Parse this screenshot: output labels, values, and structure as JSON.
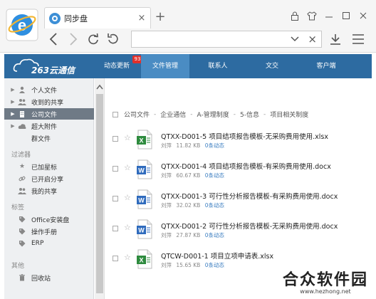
{
  "browser": {
    "tab_title": "同步盘",
    "new_tab_label": "+",
    "tab_close_label": "×",
    "address_close_label": "×"
  },
  "appnav": {
    "brand": "263云通信",
    "items": [
      {
        "label": "动态更新",
        "badge": "93",
        "active": false
      },
      {
        "label": "文件管理",
        "active": true
      },
      {
        "label": "联系人",
        "active": false
      },
      {
        "label": "文交",
        "active": false
      },
      {
        "label": "客户端",
        "active": false
      }
    ]
  },
  "sidebar": {
    "files": [
      {
        "label": "个人文件",
        "icon": "person-icon"
      },
      {
        "label": "收到的共享",
        "icon": "people-icon"
      },
      {
        "label": "公司文件",
        "icon": "building-icon",
        "selected": true
      },
      {
        "label": "超大附件",
        "icon": "cloud-icon"
      },
      {
        "label": "群文件",
        "icon": "group-icon"
      }
    ],
    "filter_header": "过滤器",
    "filters": [
      {
        "label": "已加星标",
        "icon": "star-icon"
      },
      {
        "label": "已开启分享",
        "icon": "link-icon"
      },
      {
        "label": "我的共享",
        "icon": "people-icon"
      }
    ],
    "tags_header": "标签",
    "tags": [
      {
        "label": "Office安装盘",
        "icon": "tag-icon"
      },
      {
        "label": "操作手册",
        "icon": "tag-icon"
      },
      {
        "label": "ERP",
        "icon": "tag-icon"
      }
    ],
    "other_header": "其他",
    "other": [
      {
        "label": "回收站",
        "icon": "trash-icon"
      }
    ]
  },
  "breadcrumb": [
    "公司文件",
    "企业通信",
    "A-管理制度",
    "5-信息",
    "项目相关制度"
  ],
  "breadcrumb_sep": "-",
  "files": [
    {
      "name": "QTXX-D001-5 项目结项报告模板-无采购费用使用.xlsx",
      "type": "xlsx",
      "owner": "刘萍",
      "size": "11.82 KB",
      "activity": "0条动态"
    },
    {
      "name": "QTXX-D001-4 项目结项报告模板-有采购费用使用.docx",
      "type": "docx",
      "owner": "刘萍",
      "size": "60.67 KB",
      "activity": "0条动态"
    },
    {
      "name": "QTXX-D001-3 可行性分析报告模板-有采购费用使用.docx",
      "type": "docx",
      "owner": "刘萍",
      "size": "32.02 KB",
      "activity": "0条动态"
    },
    {
      "name": "QTXX-D001-2 可行性分析报告模板-无采购费用使用.docx",
      "type": "docx",
      "owner": "刘萍",
      "size": "27.87 KB",
      "activity": "0条动态"
    },
    {
      "name": "QTCW-D001-1 项目立项申请表.xlsx",
      "type": "xlsx",
      "owner": "刘萍",
      "size": "15.65 KB",
      "activity": "0条动态"
    }
  ],
  "watermark": {
    "title": "合众软件园",
    "url": "www.hezhong.net"
  },
  "colors": {
    "nav_bg": "#2d6ba1",
    "nav_active": "#4a8cc3",
    "badge": "#e0302b",
    "link": "#3d7fc1",
    "excel": "#2e8b3e",
    "word": "#2f6bbd"
  }
}
